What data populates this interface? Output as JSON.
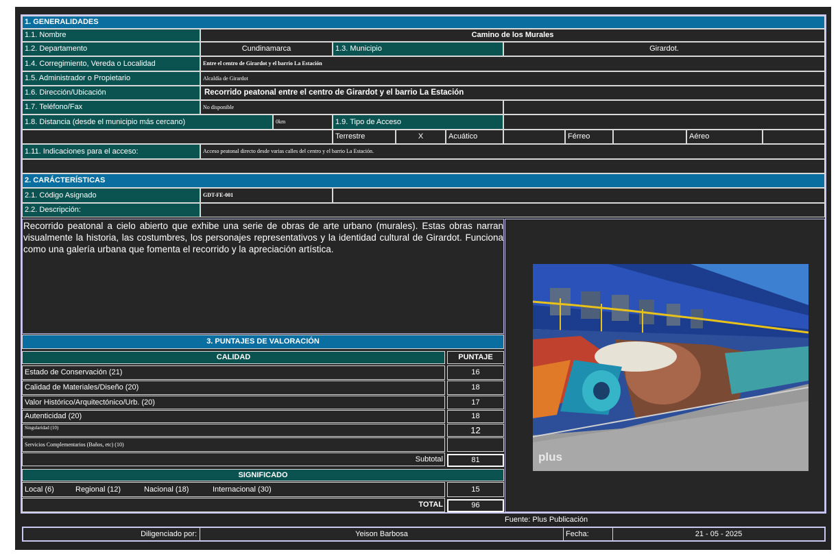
{
  "section1": {
    "title": "1. GENERALIDADES",
    "nombre_label": "1.1. Nombre",
    "nombre_value": "Camino de los Murales",
    "departamento_label": "1.2. Departamento",
    "departamento_value": "Cundinamarca",
    "municipio_label": "1.3. Municipio",
    "municipio_value": "Girardot.",
    "corregimiento_label": "1.4. Corregimiento, Vereda o Localidad",
    "corregimiento_value": "Entre el centro de Girardot y el barrio La Estación",
    "administrador_label": "1.5. Administrador o Propietario",
    "administrador_value": "Alcaldía de Girardot",
    "direccion_label": "1.6. Dirección/Ubicación",
    "direccion_value": "Recorrido peatonal entre el centro de Girardot y el barrio La Estación",
    "telefono_label": "1.7. Teléfono/Fax",
    "telefono_value": "No disponible",
    "distancia_label": "1.8. Distancia (desde el municipio más cercano)",
    "distancia_value": "0km",
    "acceso_label": "1.9. Tipo de Acceso",
    "terrestre": "Terrestre",
    "terrestre_mark": "X",
    "acuatico": "Acuático",
    "ferreo": "Férreo",
    "aereo": "Aéreo",
    "indicaciones_label": "1.11. Indicaciones para el acceso:",
    "indicaciones_value": "Acceso peatonal directo desde varias calles del centro y el barrio La Estación."
  },
  "section2": {
    "title": "2. CARÁCTERÍSTICAS",
    "codigo_label": "2.1. Código Asignado",
    "codigo_value": "GDT-FE-001",
    "descripcion_label": "2.2. Descripción:",
    "descripcion_text": "Recorrido peatonal a cielo abierto que exhibe una serie de obras de arte urbano (murales). Estas obras narran visualmente la historia, las costumbres, los personajes representativos y la identidad cultural de Girardot. Funciona como una galería urbana que fomenta el recorrido y la apreciación artística."
  },
  "section3": {
    "title": "3. PUNTAJES DE VALORACIÓN",
    "calidad_header": "CALIDAD",
    "puntaje_header": "PUNTAJE",
    "calidad_rows": [
      {
        "label": "Estado de Conservación (21)",
        "score": "16"
      },
      {
        "label": "Calidad de Materiales/Diseño (20)",
        "score": "18"
      },
      {
        "label": "Valor Histórico/Arquitectónico/Urb. (20)",
        "score": "17"
      },
      {
        "label": "Autenticidad (20)",
        "score": "18"
      },
      {
        "label": "Singularidad (10)",
        "score": "12"
      },
      {
        "label": "Servicios Complementarios (Baños, etc) (10)",
        "score": ""
      }
    ],
    "subtotal_label": "Subtotal",
    "subtotal_value": "81",
    "significado_header": "SIGNIFICADO",
    "local": "Local (6)",
    "regional": "Regional (12)",
    "nacional": "Nacional (18)",
    "internacional": "Internacional (30)",
    "significado_value": "15",
    "total_label": "TOTAL",
    "total_value": "96"
  },
  "photo": {
    "watermark": "plus",
    "source": "Fuente: Plus Publicación"
  },
  "footer": {
    "diligenciado_label": "Diligenciado por:",
    "diligenciado_value": "Yeison Barbosa",
    "fecha_label": "Fecha:",
    "fecha_value": "21 - 05 - 2025"
  },
  "colors": {
    "section_blue": "#0a6fa0",
    "label_teal": "#0b5350",
    "background": "#262626",
    "border": "#c8c8f0"
  }
}
